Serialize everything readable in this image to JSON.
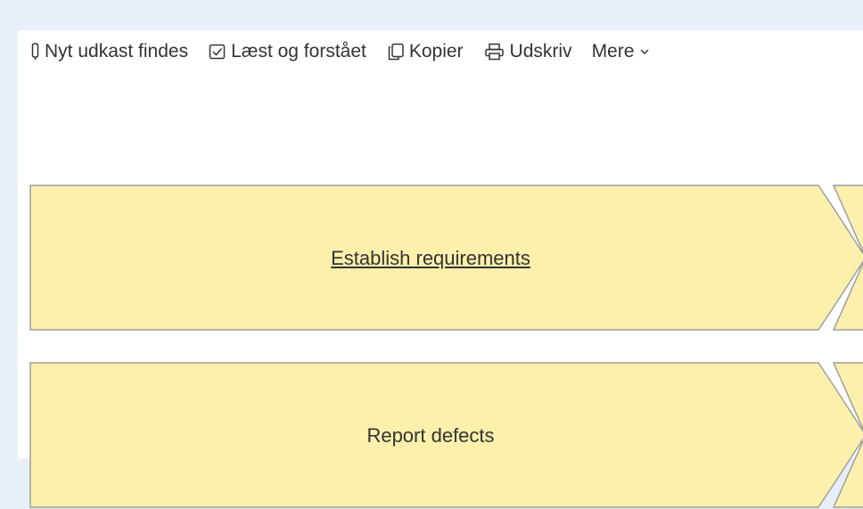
{
  "toolbar": {
    "items": [
      {
        "label": "Nyt udkast findes",
        "icon": "draft-icon"
      },
      {
        "label": "Læst og forstået",
        "icon": "checkbox-icon"
      },
      {
        "label": "Kopier",
        "icon": "copy-icon"
      },
      {
        "label": "Udskriv",
        "icon": "print-icon"
      },
      {
        "label": "Mere",
        "icon": "chevron-down-icon"
      }
    ]
  },
  "processes": [
    {
      "label": "Establish requirements"
    },
    {
      "label": "Report defects"
    }
  ],
  "colors": {
    "background": "#e9eff7",
    "panel": "#ffffff",
    "shape_fill": "#fcf0ac",
    "shape_stroke": "#9e9e9e",
    "text": "#333333"
  }
}
